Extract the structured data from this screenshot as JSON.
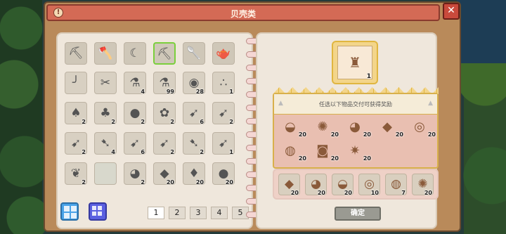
{
  "window": {
    "title": "贝壳类",
    "info_icon": "info-icon",
    "close_icon": "close-icon",
    "info_label": "!",
    "close_label": "✕"
  },
  "left_page": {
    "tools": [
      {
        "name": "pickaxe-icon",
        "glyph": "⛏"
      },
      {
        "name": "axe-icon",
        "glyph": "🪓"
      },
      {
        "name": "sickle-icon",
        "glyph": "☾"
      },
      {
        "name": "hoe-icon",
        "glyph": "⛏",
        "selected": true
      },
      {
        "name": "shovel-icon",
        "glyph": "🥄"
      },
      {
        "name": "watering-can-icon",
        "glyph": "🫖"
      }
    ],
    "items": [
      {
        "name": "fishing-rod-icon",
        "glyph": "╯",
        "qty": ""
      },
      {
        "name": "scissors-icon",
        "glyph": "✂",
        "qty": ""
      },
      {
        "name": "potion-icon",
        "glyph": "⚗",
        "qty": "4"
      },
      {
        "name": "potion-icon",
        "glyph": "⚗",
        "qty": "99"
      },
      {
        "name": "barrel-icon",
        "glyph": "◉",
        "qty": "28"
      },
      {
        "name": "seeds-icon",
        "glyph": "∴",
        "qty": "1"
      },
      {
        "name": "mushroom-icon",
        "glyph": "♠",
        "qty": "2"
      },
      {
        "name": "mushroom-icon",
        "glyph": "♣",
        "qty": "2"
      },
      {
        "name": "egg-icon",
        "glyph": "●",
        "qty": "2"
      },
      {
        "name": "plant-icon",
        "glyph": "✿",
        "qty": "2"
      },
      {
        "name": "fish-icon",
        "glyph": "➹",
        "qty": "6"
      },
      {
        "name": "fish-icon",
        "glyph": "➹",
        "qty": "2"
      },
      {
        "name": "fish-icon",
        "glyph": "➹",
        "qty": "2"
      },
      {
        "name": "fish-icon",
        "glyph": "➷",
        "qty": "4"
      },
      {
        "name": "fish-icon",
        "glyph": "➹",
        "qty": "6"
      },
      {
        "name": "fish-icon",
        "glyph": "➹",
        "qty": "2"
      },
      {
        "name": "fish-icon",
        "glyph": "➷",
        "qty": "2"
      },
      {
        "name": "fish-icon",
        "glyph": "➹",
        "qty": "1"
      },
      {
        "name": "leaf-icon",
        "glyph": "❦",
        "qty": "2"
      },
      {
        "name": "empty-slot",
        "glyph": "",
        "qty": "",
        "empty": true
      },
      {
        "name": "shell-icon",
        "glyph": "◕",
        "qty": "2"
      },
      {
        "name": "ore-icon",
        "glyph": "◆",
        "qty": "20"
      },
      {
        "name": "drop-icon",
        "glyph": "♦",
        "qty": "20"
      },
      {
        "name": "coal-icon",
        "glyph": "●",
        "qty": "20"
      }
    ],
    "pages": [
      "1",
      "2",
      "3",
      "4",
      "5"
    ],
    "active_page": "1"
  },
  "right_page": {
    "target": {
      "name": "shell-target-icon",
      "glyph": "♜",
      "qty": "1"
    },
    "reward_text": "任选以下物品交付可获得奖励",
    "rewards": [
      {
        "name": "scallop-icon",
        "glyph": "◒",
        "qty": "20"
      },
      {
        "name": "sea-urchin-icon",
        "glyph": "✺",
        "qty": "20"
      },
      {
        "name": "conch-icon",
        "glyph": "◕",
        "qty": "20"
      },
      {
        "name": "green-shell-icon",
        "glyph": "◆",
        "qty": "20"
      },
      {
        "name": "snail-shell-icon",
        "glyph": "◎",
        "qty": "20"
      },
      {
        "name": "clam-icon",
        "glyph": "◍",
        "qty": "20"
      },
      {
        "name": "crab-icon",
        "glyph": "◙",
        "qty": "20"
      },
      {
        "name": "starfish-icon",
        "glyph": "✷",
        "qty": "20"
      }
    ],
    "deliver": [
      {
        "name": "green-shell-icon",
        "glyph": "◆",
        "qty": "20"
      },
      {
        "name": "conch-icon",
        "glyph": "◕",
        "qty": "20"
      },
      {
        "name": "scallop-icon",
        "glyph": "◒",
        "qty": "20"
      },
      {
        "name": "snail-shell-icon",
        "glyph": "◎",
        "qty": "10"
      },
      {
        "name": "clam-icon",
        "glyph": "◍",
        "qty": "7"
      },
      {
        "name": "sea-urchin-icon",
        "glyph": "✺",
        "qty": "20"
      }
    ],
    "confirm_label": "确定"
  },
  "colors": {
    "title_bar": "#d46a55",
    "selected_slot": "#7bcf3c",
    "reward_border": "#d8b04b",
    "grid_view_button": "#4aa3e8",
    "list_view_button": "#5a5fe0"
  }
}
